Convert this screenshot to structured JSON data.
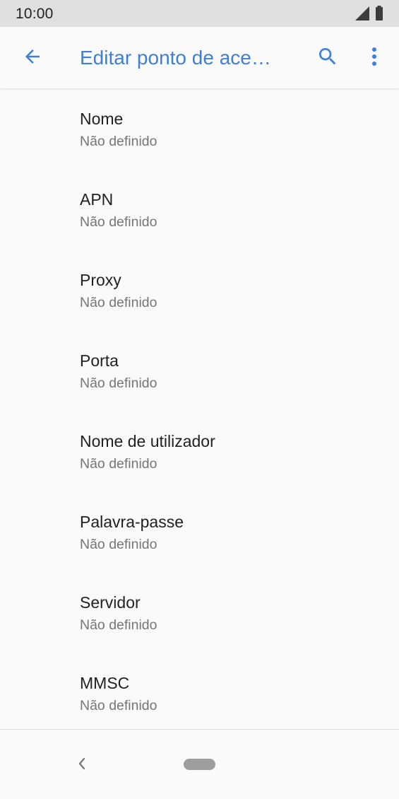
{
  "status_bar": {
    "time": "10:00",
    "icons": [
      "signal-icon",
      "battery-icon"
    ]
  },
  "app_bar": {
    "title": "Editar ponto de ace…",
    "icons": [
      "back-arrow-icon",
      "search-icon",
      "more-vert-icon"
    ],
    "accent_color": "#3d7fd9"
  },
  "settings": {
    "items": [
      {
        "title": "Nome",
        "summary": "Não definido"
      },
      {
        "title": "APN",
        "summary": "Não definido"
      },
      {
        "title": "Proxy",
        "summary": "Não definido"
      },
      {
        "title": "Porta",
        "summary": "Não definido"
      },
      {
        "title": "Nome de utilizador",
        "summary": "Não definido"
      },
      {
        "title": "Palavra-passe",
        "summary": "Não definido"
      },
      {
        "title": "Servidor",
        "summary": "Não definido"
      },
      {
        "title": "MMSC",
        "summary": "Não definido"
      }
    ]
  },
  "nav_bar": {
    "icons": [
      "nav-back-icon",
      "home-pill-icon"
    ]
  }
}
